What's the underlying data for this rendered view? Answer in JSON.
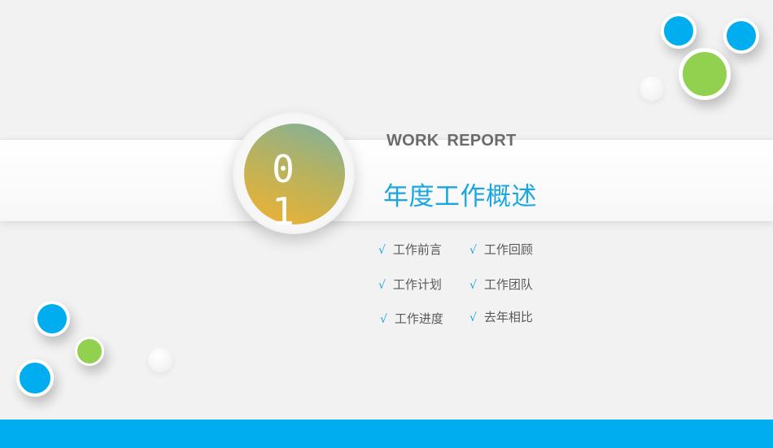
{
  "slide": {
    "number": "01",
    "subtitle": "WORK REPORT",
    "title": "年度工作概述",
    "check_mark": "√",
    "menu": [
      {
        "label": "工作前言"
      },
      {
        "label": "工作回顾"
      },
      {
        "label": "工作计划"
      },
      {
        "label": "工作团队"
      },
      {
        "label": "工作进度"
      },
      {
        "label": "去年相比"
      }
    ]
  },
  "colors": {
    "accent_blue": "#00aeef",
    "accent_green": "#92d050",
    "title_blue": "#1aa7e0",
    "subtitle_gray": "#6b6b6b",
    "badge_gradient": [
      "#7fb0a0",
      "#b6b260",
      "#f2b230"
    ]
  }
}
